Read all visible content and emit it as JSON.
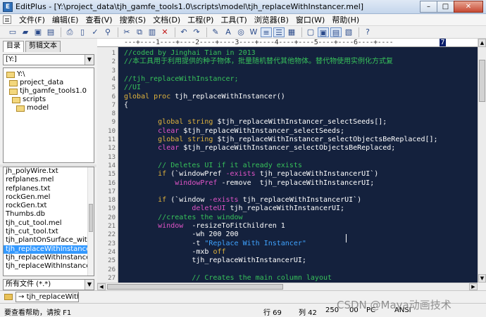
{
  "window": {
    "title": "EditPlus - [Y:\\project_data\\tjh_gamfe_tools1.0\\scripts\\model\\tjh_replaceWithInstancer.mel]",
    "icon": "editplus-app-icon",
    "minimize": "–",
    "maximize": "□",
    "close": "✕"
  },
  "menu": [
    "文件(F)",
    "编辑(E)",
    "查看(V)",
    "搜索(S)",
    "文档(D)",
    "工程(P)",
    "工具(T)",
    "浏览器(B)",
    "窗口(W)",
    "帮助(H)"
  ],
  "toolbar": {
    "icons": [
      "new-file",
      "open-file",
      "save",
      "save-all",
      "print",
      "print-preview",
      "spell-check",
      "find",
      "cut",
      "copy",
      "paste",
      "delete",
      "undo",
      "redo",
      "find-text",
      "replace",
      "browser",
      "word-wrap",
      "line-numbers",
      "ruler",
      "column-select",
      "toggle-window",
      "cliptext",
      "directory",
      "help"
    ]
  },
  "sidebar": {
    "tabs": [
      "目录",
      "剪辑文本"
    ],
    "drive": "[Y:]",
    "tree": [
      {
        "label": "Y:\\",
        "level": 0,
        "open": true
      },
      {
        "label": "project_data",
        "level": 1,
        "open": true
      },
      {
        "label": "tjh_gamfe_tools1.0",
        "level": 1,
        "open": true
      },
      {
        "label": "scripts",
        "level": 2,
        "open": true
      },
      {
        "label": "model",
        "level": 3,
        "open": true
      }
    ],
    "files": [
      "jh_polyWire.txt",
      "refplanes.mel",
      "refplanes.txt",
      "rockGen.mel",
      "rockGen.txt",
      "Thumbs.db",
      "tjh_cut_tool.mel",
      "tjh_cut_tool.txt",
      "tjh_plantOnSurface_withFoll",
      "tjh_replaceWithInstancer.me",
      "tjh_replaceWithInstancer.mo",
      "tjh_replaceWithInstancer.txt"
    ],
    "selected_file_index": 9,
    "filter": "所有文件 (*.*)"
  },
  "editor": {
    "ruler": "---+----1----+----2----+----3----+----4----+----5----+----6----+----",
    "ruler_mark": "7",
    "line_numbers": [
      "1",
      "2",
      "3",
      "4",
      "5",
      "6",
      "7",
      "8",
      "9",
      "10",
      "11",
      "12",
      "13",
      "14",
      "15",
      "16",
      "17",
      "18",
      "19",
      "20",
      "21",
      "22",
      "23",
      "24",
      "25",
      "26",
      "27"
    ],
    "lines": [
      [
        {
          "t": "//coded by Jinghai Tian in 2013",
          "c": "comment"
        }
      ],
      [
        {
          "t": "//本工具用于利用提供的种子物体，批量随机替代其他物体。替代物使用实例化方式复",
          "c": "comment"
        }
      ],
      [],
      [
        {
          "t": "//tjh_replaceWithInstancer;",
          "c": "comment"
        }
      ],
      [
        {
          "t": "//UI",
          "c": "comment"
        }
      ],
      [
        {
          "t": "global proc ",
          "c": "kw"
        },
        {
          "t": "tjh_replaceWithInstancer()",
          "c": "txt"
        }
      ],
      [
        {
          "t": "{",
          "c": "txt"
        }
      ],
      [],
      [
        {
          "t": "        global string ",
          "c": "kw"
        },
        {
          "t": "$tjh_replaceWithInstancer_selectSeeds[];",
          "c": "txt"
        }
      ],
      [
        {
          "t": "        clear ",
          "c": "kw2"
        },
        {
          "t": "$tjh_replaceWithInstancer_selectSeeds;",
          "c": "txt"
        }
      ],
      [
        {
          "t": "        global string ",
          "c": "kw"
        },
        {
          "t": "$tjh_replaceWithInstancer_selectObjectsBeReplaced[];",
          "c": "txt"
        }
      ],
      [
        {
          "t": "        clear ",
          "c": "kw2"
        },
        {
          "t": "$tjh_replaceWithInstancer_selectObjectsBeReplaced;",
          "c": "txt"
        }
      ],
      [],
      [
        {
          "t": "        // Deletes UI if it already exists",
          "c": "comment"
        }
      ],
      [
        {
          "t": "        if ",
          "c": "kw"
        },
        {
          "t": "(`windowPref ",
          "c": "txt"
        },
        {
          "t": "-exists ",
          "c": "kw2"
        },
        {
          "t": "tjh_replaceWithInstancerUI`)",
          "c": "txt"
        }
      ],
      [
        {
          "t": "            windowPref ",
          "c": "kw2"
        },
        {
          "t": "-remove  tjh_replaceWithInstancerUI;",
          "c": "txt"
        }
      ],
      [],
      [
        {
          "t": "        if ",
          "c": "kw"
        },
        {
          "t": "(`window ",
          "c": "txt"
        },
        {
          "t": "-exists ",
          "c": "kw2"
        },
        {
          "t": "tjh_replaceWithInstancerUI`)",
          "c": "txt"
        }
      ],
      [
        {
          "t": "                deleteUI ",
          "c": "kw2"
        },
        {
          "t": "tjh_replaceWithInstancerUI;",
          "c": "txt"
        }
      ],
      [
        {
          "t": "        //creates the window",
          "c": "comment"
        }
      ],
      [
        {
          "t": "        window  ",
          "c": "kw2"
        },
        {
          "t": "-resizeToFitChildren 1",
          "c": "txt"
        }
      ],
      [
        {
          "t": "                -wh 200 200",
          "c": "txt"
        }
      ],
      [
        {
          "t": "                -t ",
          "c": "txt"
        },
        {
          "t": "\"Replace With Instancer\"",
          "c": "str"
        }
      ],
      [
        {
          "t": "                -mxb ",
          "c": "txt"
        },
        {
          "t": "off",
          "c": "kw"
        }
      ],
      [
        {
          "t": "                tjh_replaceWithInstancerUI;",
          "c": "txt"
        }
      ],
      [],
      [
        {
          "t": "                // Creates the main column layout",
          "c": "comment"
        }
      ]
    ]
  },
  "doc_tab": "tjh_replaceWithInst",
  "status": {
    "help": "要查看帮助，请按 F1",
    "line": "行 69",
    "col": "列 42",
    "count": "250",
    "mode": "00",
    "pc": "PC",
    "encoding": "ANSI"
  },
  "watermark": "CSDN @Maya动画技术",
  "colors": {
    "editor_bg": "#14213d",
    "comment": "#37c15a",
    "keyword": "#e0b33c",
    "keyword2": "#e054c7",
    "string": "#3fa3ff",
    "selection": "#3399ff"
  }
}
